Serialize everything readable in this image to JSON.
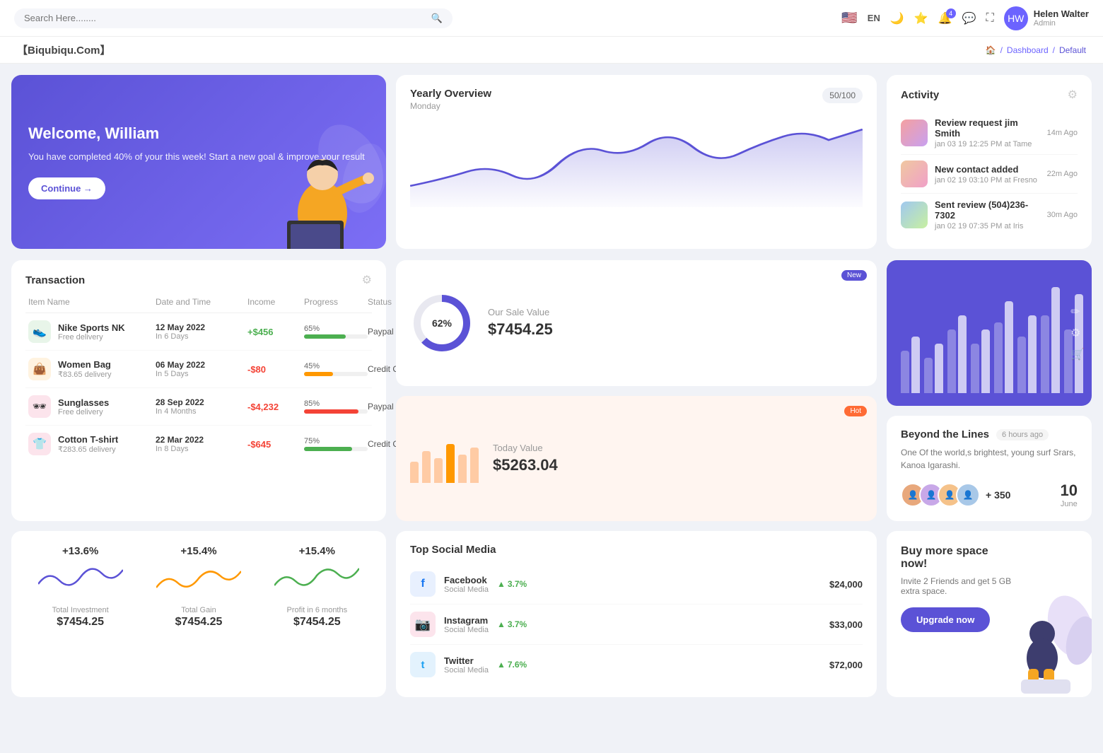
{
  "topnav": {
    "search_placeholder": "Search Here........",
    "lang": "EN",
    "user": {
      "name": "Helen Walter",
      "role": "Admin",
      "initials": "HW"
    },
    "notification_count": "4"
  },
  "breadcrumb": {
    "brand": "【Biqubiqu.Com】",
    "home_icon": "🏠",
    "items": [
      "Dashboard",
      "Default"
    ]
  },
  "welcome": {
    "title": "Welcome, William",
    "message": "You have completed 40% of your this week! Start a new goal & improve your result",
    "button": "Continue →"
  },
  "yearly_overview": {
    "title": "Yearly Overview",
    "subtitle": "Monday",
    "badge": "50/100"
  },
  "activity": {
    "title": "Activity",
    "items": [
      {
        "title": "Review request jim Smith",
        "subtitle": "jan 03 19 12:25 PM at Tame",
        "time": "14m Ago"
      },
      {
        "title": "New contact added",
        "subtitle": "jan 02 19 03:10 PM at Fresno",
        "time": "22m Ago"
      },
      {
        "title": "Sent review (504)236-7302",
        "subtitle": "jan 02 19 07:35 PM at Iris",
        "time": "30m Ago"
      }
    ]
  },
  "transaction": {
    "title": "Transaction",
    "columns": [
      "Item Name",
      "Date and Time",
      "Income",
      "Progress",
      "Status"
    ],
    "rows": [
      {
        "name": "Nike Sports NK",
        "sub": "Free delivery",
        "date": "12 May 2022",
        "period": "In 6 Days",
        "income": "+$456",
        "positive": true,
        "progress": 65,
        "progress_color": "#4caf50",
        "payment": "Paypal",
        "icon": "👟",
        "icon_bg": "#e8f5e9"
      },
      {
        "name": "Women Bag",
        "sub": "₹83.65 delivery",
        "date": "06 May 2022",
        "period": "In 5 Days",
        "income": "-$80",
        "positive": false,
        "progress": 45,
        "progress_color": "#ff9800",
        "payment": "Credit Card",
        "icon": "👜",
        "icon_bg": "#fff3e0"
      },
      {
        "name": "Sunglasses",
        "sub": "Free delivery",
        "date": "28 Sep 2022",
        "period": "In 4 Months",
        "income": "-$4,232",
        "positive": false,
        "progress": 85,
        "progress_color": "#f44336",
        "payment": "Paypal",
        "icon": "🕶",
        "icon_bg": "#fce4ec"
      },
      {
        "name": "Cotton T-shirt",
        "sub": "₹283.65 delivery",
        "date": "22 Mar 2022",
        "period": "In 8 Days",
        "income": "-$645",
        "positive": false,
        "progress": 75,
        "progress_color": "#4caf50",
        "payment": "Credit Card",
        "icon": "👕",
        "icon_bg": "#fce4ec"
      }
    ]
  },
  "sale_new": {
    "badge": "New",
    "label": "Our Sale Value",
    "value": "$7454.25",
    "percent": 62
  },
  "sale_hot": {
    "badge": "Hot",
    "label": "Today Value",
    "value": "$5263.04"
  },
  "beyond": {
    "title": "Beyond the Lines",
    "time": "6 hours ago",
    "desc": "One Of the world,s brightest, young surf Srars, Kanoa Igarashi.",
    "plus_count": "+ 350",
    "date_num": "10",
    "date_month": "June"
  },
  "stats": [
    {
      "pct": "+13.6%",
      "label": "Total Investment",
      "value": "$7454.25",
      "color": "#5b52d6"
    },
    {
      "pct": "+15.4%",
      "label": "Total Gain",
      "value": "$7454.25",
      "color": "#ff9800"
    },
    {
      "pct": "+15.4%",
      "label": "Profit in 6 months",
      "value": "$7454.25",
      "color": "#4caf50"
    }
  ],
  "social": {
    "title": "Top Social Media",
    "items": [
      {
        "name": "Facebook",
        "sub": "Social Media",
        "pct": "3.7%",
        "value": "$24,000",
        "icon": "f",
        "icon_bg": "#e8f0fe",
        "icon_color": "#1877f2"
      },
      {
        "name": "Instagram",
        "sub": "Social Media",
        "pct": "3.7%",
        "value": "$33,000",
        "icon": "📷",
        "icon_bg": "#fce4ec",
        "icon_color": "#e91e63"
      },
      {
        "name": "Twitter",
        "sub": "Social Media",
        "pct": "7.6%",
        "value": "$72,000",
        "icon": "t",
        "icon_bg": "#e3f2fd",
        "icon_color": "#1da1f2"
      }
    ]
  },
  "promo": {
    "title": "Buy more space now!",
    "desc": "Invite 2 Friends and get 5 GB extra space.",
    "button": "Upgrade now"
  }
}
